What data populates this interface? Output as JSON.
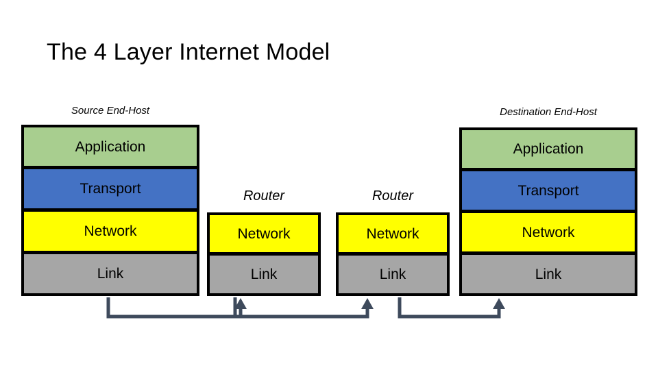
{
  "slide": {
    "title": "The 4 Layer Internet Model",
    "background": "#ffffff"
  },
  "colors": {
    "application": "#A8CE8F",
    "transport": "#4472C4",
    "network": "#FFFF00",
    "link": "#A6A6A6",
    "border": "#000000",
    "connector": "#3E4A5C",
    "text": "#000000"
  },
  "labels": {
    "source_host": "Source End-Host",
    "destination_host": "Destination End-Host",
    "router_1": "Router",
    "router_2": "Router"
  },
  "nodes": [
    {
      "id": "source-end-host",
      "kind": "end-host",
      "label": "Source End-Host",
      "layers": [
        {
          "name": "Application",
          "color": "#A8CE8F"
        },
        {
          "name": "Transport",
          "color": "#4472C4"
        },
        {
          "name": "Network",
          "color": "#FFFF00"
        },
        {
          "name": "Link",
          "color": "#A6A6A6"
        }
      ]
    },
    {
      "id": "router-1",
      "kind": "router",
      "label": "Router",
      "layers": [
        {
          "name": "Network",
          "color": "#FFFF00"
        },
        {
          "name": "Link",
          "color": "#A6A6A6"
        }
      ]
    },
    {
      "id": "router-2",
      "kind": "router",
      "label": "Router",
      "layers": [
        {
          "name": "Network",
          "color": "#FFFF00"
        },
        {
          "name": "Link",
          "color": "#A6A6A6"
        }
      ]
    },
    {
      "id": "destination-end-host",
      "kind": "end-host",
      "label": "Destination End-Host",
      "layers": [
        {
          "name": "Application",
          "color": "#A8CE8F"
        },
        {
          "name": "Transport",
          "color": "#4472C4"
        },
        {
          "name": "Network",
          "color": "#FFFF00"
        },
        {
          "name": "Link",
          "color": "#A6A6A6"
        }
      ]
    }
  ],
  "connections": [
    {
      "id": "link-source-to-router-1",
      "from": "source-end-host",
      "to": "router-1",
      "direction": "up-arrow"
    },
    {
      "id": "link-router-1-to-router-2",
      "from": "router-1",
      "to": "router-2",
      "direction": "up-arrow"
    },
    {
      "id": "link-router-2-to-destination",
      "from": "router-2",
      "to": "destination-end-host",
      "direction": "up-arrow"
    }
  ]
}
